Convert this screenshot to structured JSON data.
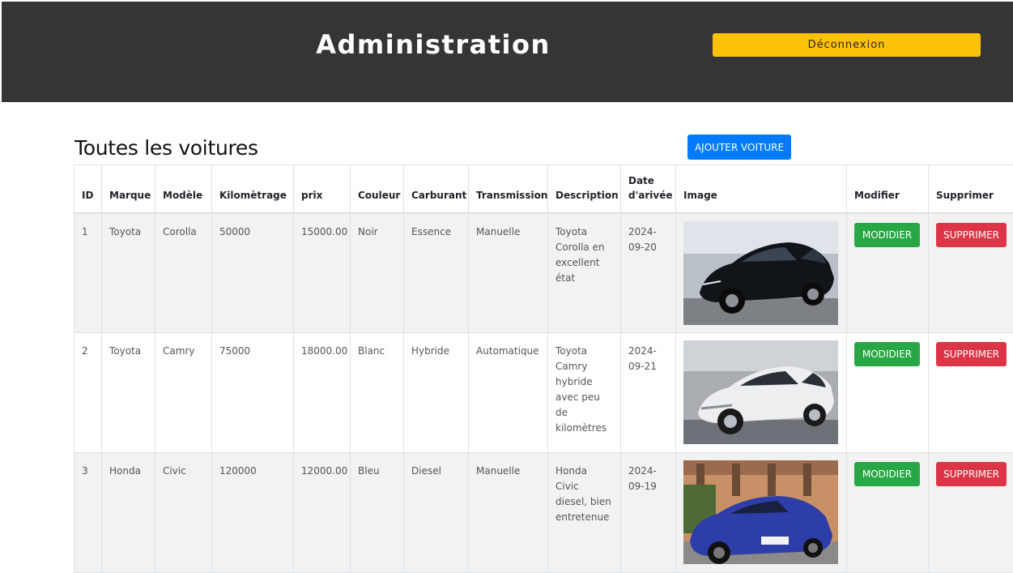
{
  "header": {
    "title": "Administration",
    "logout_label": "Déconnexion"
  },
  "main": {
    "title": "Toutes les voitures",
    "add_button_label": "AJOUTER VOITURE"
  },
  "table": {
    "columns": [
      "ID",
      "Marque",
      "Modèle",
      "Kilomètrage",
      "prix",
      "Couleur",
      "Carburant",
      "Transmission",
      "Description",
      "Date d'arivée",
      "Image",
      "Modifier",
      "Supprimer"
    ],
    "rows": [
      {
        "id": "1",
        "marque": "Toyota",
        "modele": "Corolla",
        "kilometrage": "50000",
        "prix": "15000.00",
        "couleur": "Noir",
        "carburant": "Essence",
        "transmission": "Manuelle",
        "description": "Toyota Corolla en excellent état",
        "date": "2024-09-20",
        "modifier_label": "MODIDIER",
        "supprimer_label": "SUPPRIMER"
      },
      {
        "id": "2",
        "marque": "Toyota",
        "modele": "Camry",
        "kilometrage": "75000",
        "prix": "18000.00",
        "couleur": "Blanc",
        "carburant": "Hybride",
        "transmission": "Automatique",
        "description": "Toyota Camry hybride avec peu de kilomètres",
        "date": "2024-09-21",
        "modifier_label": "MODIDIER",
        "supprimer_label": "SUPPRIMER"
      },
      {
        "id": "3",
        "marque": "Honda",
        "modele": "Civic",
        "kilometrage": "120000",
        "prix": "12000.00",
        "couleur": "Bleu",
        "carburant": "Diesel",
        "transmission": "Manuelle",
        "description": "Honda Civic diesel, bien entretenue",
        "date": "2024-09-19",
        "modifier_label": "MODIDIER",
        "supprimer_label": "SUPPRIMER"
      }
    ]
  },
  "colors": {
    "header_bg": "#353535",
    "logout": "#ffc107",
    "add": "#007bff",
    "modify": "#28a745",
    "delete": "#dc3545"
  }
}
